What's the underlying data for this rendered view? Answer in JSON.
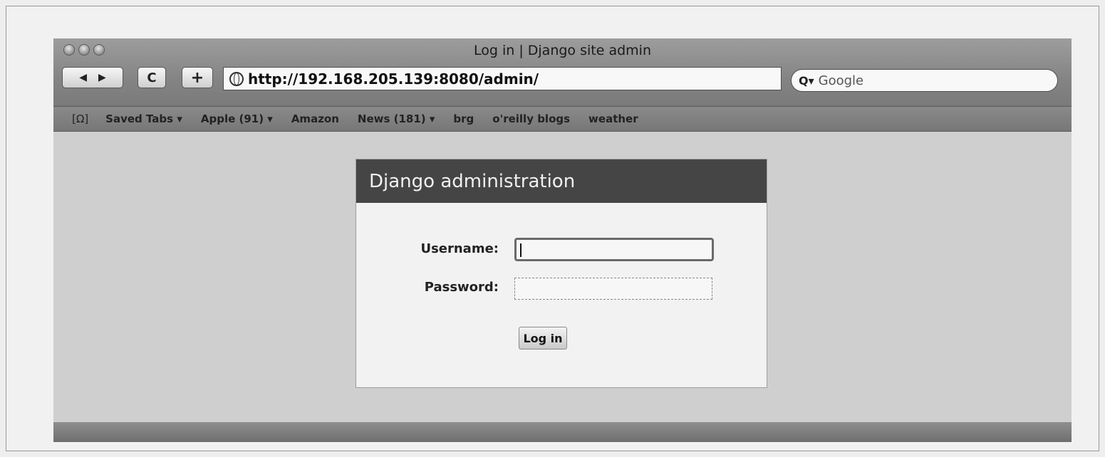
{
  "window": {
    "title": "Log in | Django site admin"
  },
  "toolbar": {
    "back_glyph": "◀",
    "forward_glyph": "▶",
    "reload_glyph": "C",
    "add_bookmark_glyph": "+",
    "url": "http://192.168.205.139:8080/admin/",
    "search_placeholder": "Google",
    "search_glyph": "Q▾"
  },
  "bookmarks": {
    "icon_glyph": "[Ω]",
    "items": [
      {
        "label": "Saved Tabs ▾"
      },
      {
        "label": "Apple (91) ▾"
      },
      {
        "label": "Amazon"
      },
      {
        "label": "News (181) ▾"
      },
      {
        "label": "brg"
      },
      {
        "label": "o'reilly blogs"
      },
      {
        "label": "weather"
      }
    ]
  },
  "login": {
    "header": "Django administration",
    "username_label": "Username:",
    "password_label": "Password:",
    "username_value": "",
    "password_value": "",
    "submit_label": "Log in"
  }
}
